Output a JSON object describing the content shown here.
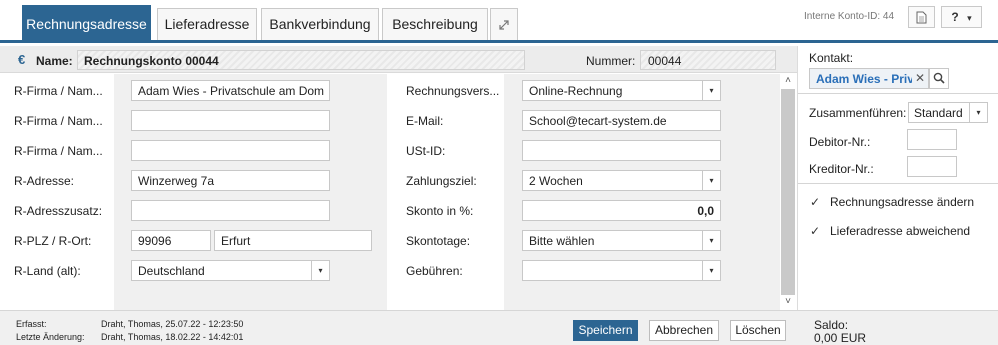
{
  "tabs": [
    {
      "label": "Rechnungsadresse"
    },
    {
      "label": "Lieferadresse"
    },
    {
      "label": "Bankverbindung"
    },
    {
      "label": "Beschreibung"
    }
  ],
  "toolbar": {
    "expand_icon": "expand-icon",
    "konto_id_label": "Interne Konto-ID: 44",
    "doc_icon": "document-icon",
    "help_label": "?",
    "help_arrow": "▾"
  },
  "header": {
    "euro_symbol": "€",
    "name_label": "Name:",
    "name_value": "Rechnungskonto 00044",
    "number_label": "Nummer:",
    "number_value": "00044"
  },
  "form_left": [
    {
      "label": "R-Firma / Nam...",
      "value": "Adam Wies - Privatschule am Dom"
    },
    {
      "label": "R-Firma / Nam...",
      "value": ""
    },
    {
      "label": "R-Firma / Nam...",
      "value": ""
    },
    {
      "label": "R-Adresse:",
      "value": "Winzerweg 7a"
    },
    {
      "label": "R-Adresszusatz:",
      "value": ""
    },
    {
      "label": "R-PLZ / R-Ort:",
      "plz": "99096",
      "ort": "Erfurt"
    },
    {
      "label": "R-Land (alt):",
      "value": "Deutschland"
    }
  ],
  "form_right": [
    {
      "label": "Rechnungsvers...",
      "value": "Online-Rechnung"
    },
    {
      "label": "E-Mail:",
      "value": "School@tecart-system.de"
    },
    {
      "label": "USt-ID:",
      "value": ""
    },
    {
      "label": "Zahlungsziel:",
      "value": "2 Wochen"
    },
    {
      "label": "Skonto in %:",
      "value": "0,0"
    },
    {
      "label": "Skontotage:",
      "value": "Bitte wählen"
    },
    {
      "label": "Gebühren:",
      "value": ""
    }
  ],
  "side": {
    "kontakt_label": "Kontakt:",
    "contact_value": "Adam Wies - Priv.",
    "close_glyph": "✕",
    "merge_label": "Zusammenführen:",
    "merge_value": "Standard",
    "debitor_label": "Debitor-Nr.:",
    "kreditor_label": "Kreditor-Nr.:",
    "checkbox1_label": "Rechnungsadresse ändern",
    "checkbox2_label": "Lieferadresse abweichend",
    "check_glyph": "✓",
    "checkbox1_checked": true,
    "checkbox2_checked": true
  },
  "footer": {
    "created_label": "Erfasst:",
    "created_value": "Draht, Thomas, 25.07.22 - 12:23:50",
    "changed_label": "Letzte Änderung:",
    "changed_value": "Draht, Thomas, 18.02.22 - 14:42:01",
    "save_label": "Speichern",
    "cancel_label": "Abbrechen",
    "delete_label": "Löschen",
    "saldo_label": "Saldo:",
    "saldo_value": "0,00 EUR"
  },
  "select_arrow": "▾",
  "scroll_up": "˄",
  "scroll_down": "˅",
  "colors": {
    "accent": "#2c6592",
    "link": "#2a6fb8"
  }
}
